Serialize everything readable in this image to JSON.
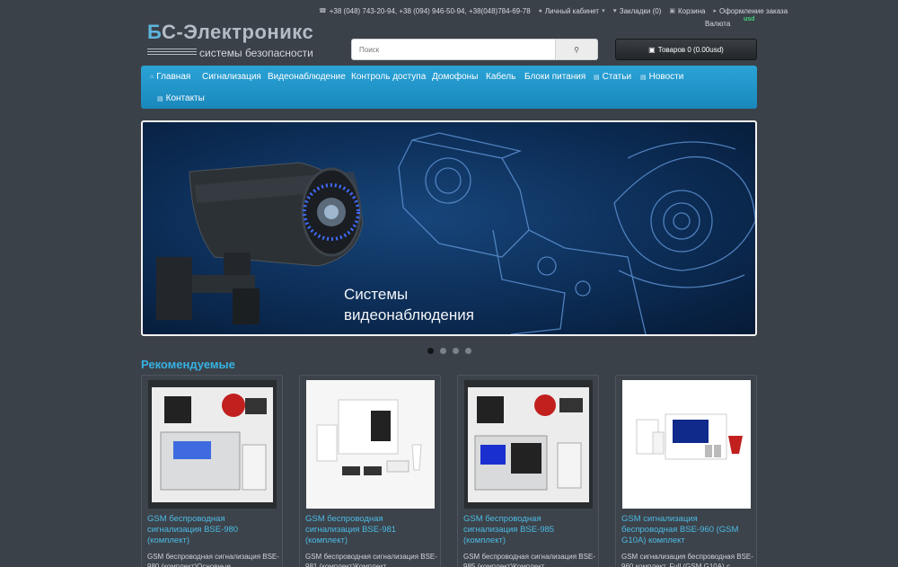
{
  "topbar": {
    "phones": "+38 (048) 743-20-94, +38 (094) 946-50-94, +38(048)784-69-78",
    "account": "Личный кабинет",
    "bookmarks": "Закладки (0)",
    "cart": "Корзина",
    "checkout": "Оформление заказа",
    "currency_label": "Валюта",
    "currency_value": "usd"
  },
  "logo": {
    "first_letter": "Б",
    "rest": "С-Электроникс",
    "tagline": "системы безопасности"
  },
  "search": {
    "placeholder": "Поиск"
  },
  "cart_button": {
    "label": "Товаров 0 (0.00usd)"
  },
  "menu": {
    "items": [
      {
        "label": "Главная"
      },
      {
        "label": "Сигнализация"
      },
      {
        "label": "Видеонаблюдение"
      },
      {
        "label": "Контроль доступа"
      },
      {
        "label": "Домофоны"
      },
      {
        "label": "Кабель"
      },
      {
        "label": "Блоки питания"
      },
      {
        "label": "Статьи"
      },
      {
        "label": "Новости"
      },
      {
        "label": "Контакты"
      }
    ]
  },
  "banner": {
    "line1": "Системы",
    "line2": "видеонаблюдения"
  },
  "carousel": {
    "count": 4,
    "active": 0
  },
  "recommended": {
    "title": "Рекомендуемые",
    "products": [
      {
        "name": "GSM беспроводная сигнализация BSE-980 (комплект)",
        "desc": "GSM беспроводная сигнализация BSE-980 (комплект)Основные"
      },
      {
        "name": "GSM беспроводная сигнализация BSE-981 (комплект)",
        "desc": "GSM беспроводная сигнализация BSE-981 (комплект)Комплект"
      },
      {
        "name": "GSM беспроводная сигнализация BSE-985 (комплект)",
        "desc": "GSM беспроводная сигнализация BSE-985 (комплект)Комплект"
      },
      {
        "name": "GSM сигнализация беспроводная BSE-960 (GSM G10A) комплект",
        "desc": "GSM сигнализация беспроводная BSE-960 комплект. Full (GSM G10A) с"
      }
    ]
  },
  "colors": {
    "background": "#3b4148",
    "accent": "#2aa3d6",
    "link": "#4bbbe7"
  }
}
